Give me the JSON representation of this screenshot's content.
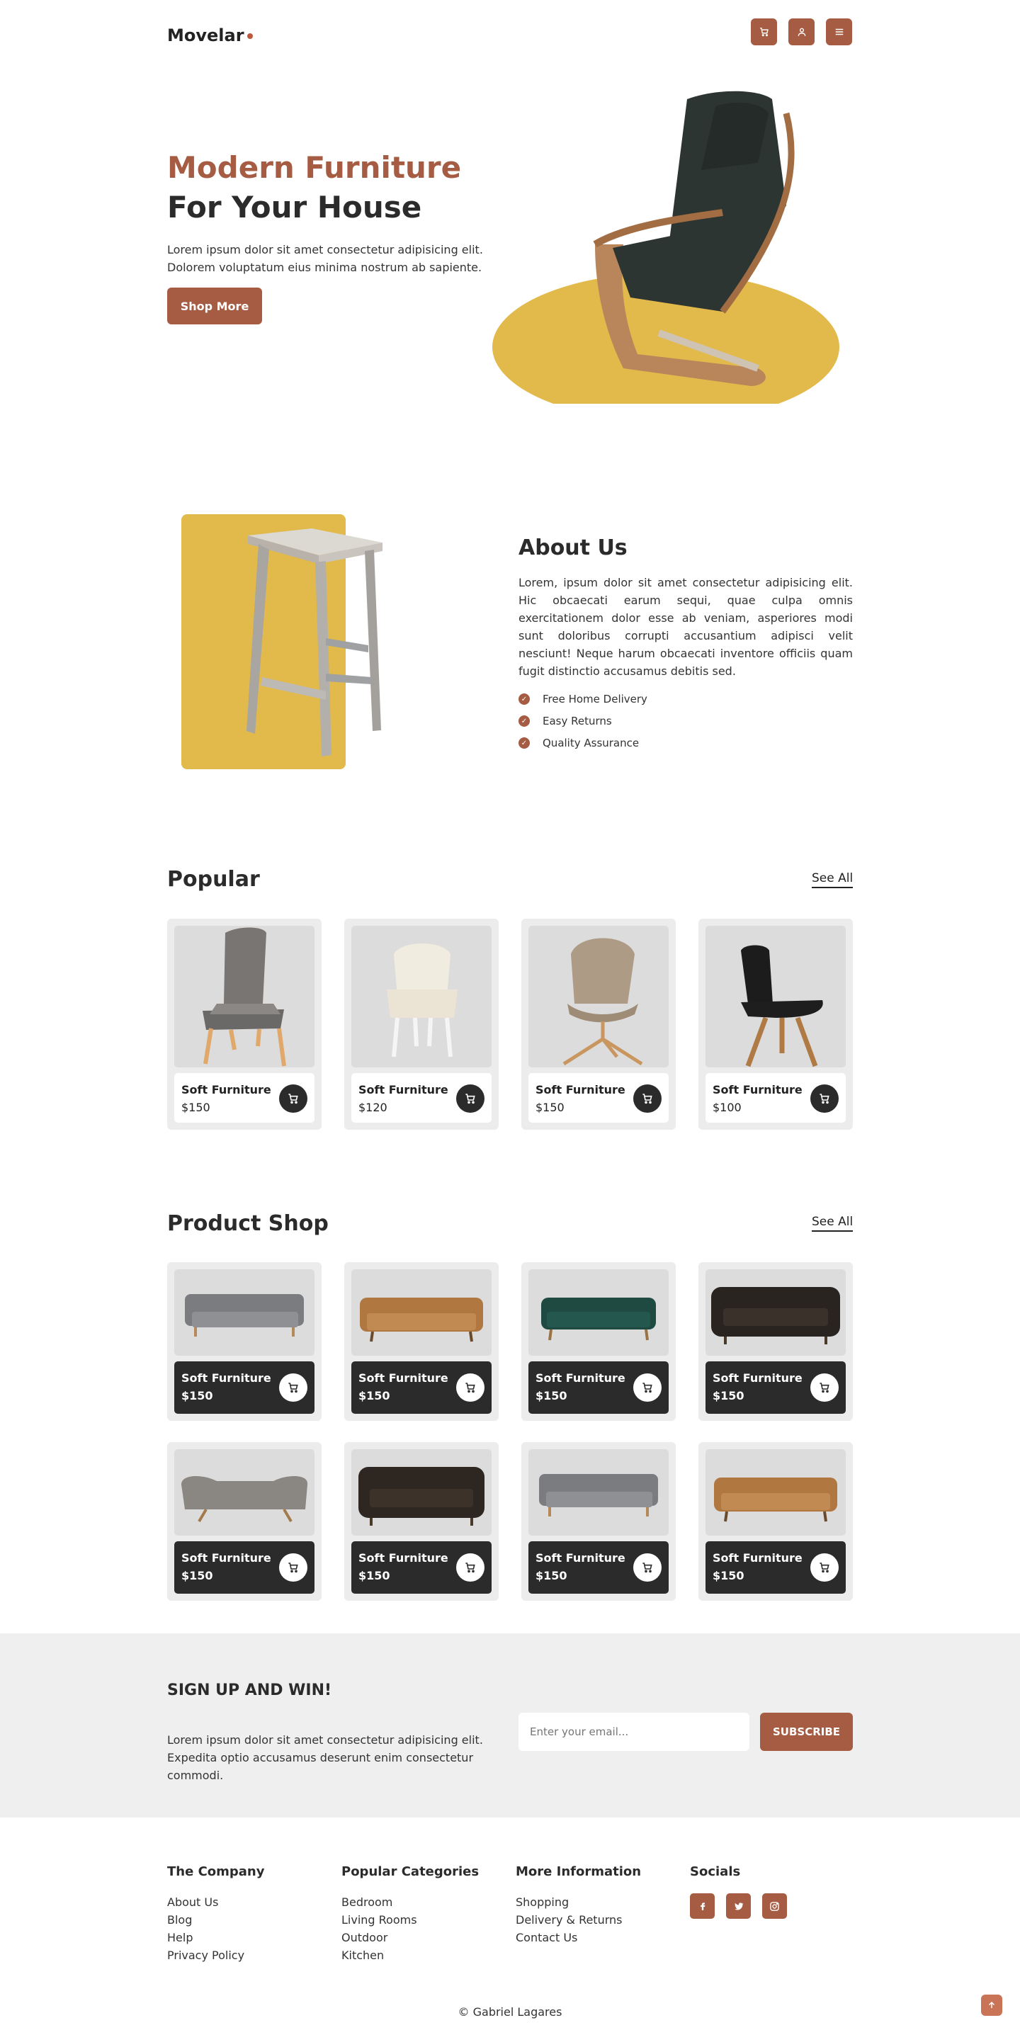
{
  "header": {
    "logo": "Movelar",
    "icons": [
      "cart-icon",
      "user-icon",
      "menu-icon"
    ]
  },
  "hero": {
    "title_accent": "Modern Furniture",
    "title_main": "For Your House",
    "paragraph": "Lorem ipsum dolor sit amet consectetur adipisicing elit. Dolorem voluptatum eius minima nostrum ab sapiente.",
    "button": "Shop More"
  },
  "about": {
    "title": "About Us",
    "paragraph": "Lorem, ipsum dolor sit amet consectetur adipisicing elit. Hic obcaecati earum sequi, quae culpa omnis exercitationem dolor esse ab veniam, asperiores modi sunt doloribus corrupti accusantium adipisci velit nesciunt! Neque harum obcaecati inventore officiis quam fugit distinctio accusamus debitis sed.",
    "features": [
      "Free Home Delivery",
      "Easy Returns",
      "Quality Assurance"
    ]
  },
  "popular": {
    "title": "Popular",
    "see_all": "See All",
    "items": [
      {
        "name": "Soft Furniture",
        "price": "$150"
      },
      {
        "name": "Soft Furniture",
        "price": "$120"
      },
      {
        "name": "Soft Furniture",
        "price": "$150"
      },
      {
        "name": "Soft Furniture",
        "price": "$100"
      }
    ]
  },
  "shop": {
    "title": "Product Shop",
    "see_all": "See All",
    "items": [
      {
        "name": "Soft Furniture",
        "price": "$150"
      },
      {
        "name": "Soft Furniture",
        "price": "$150"
      },
      {
        "name": "Soft Furniture",
        "price": "$150"
      },
      {
        "name": "Soft Furniture",
        "price": "$150"
      },
      {
        "name": "Soft Furniture",
        "price": "$150"
      },
      {
        "name": "Soft Furniture",
        "price": "$150"
      },
      {
        "name": "Soft Furniture",
        "price": "$150"
      },
      {
        "name": "Soft Furniture",
        "price": "$150"
      }
    ]
  },
  "signup": {
    "title": "SIGN UP AND WIN!",
    "paragraph": "Lorem ipsum dolor sit amet consectetur adipisicing elit. Expedita optio accusamus deserunt enim consectetur commodi.",
    "email_placeholder": "Enter your email...",
    "button": "SUBSCRIBE"
  },
  "footer": {
    "company": {
      "title": "The Company",
      "links": [
        "About Us",
        "Blog",
        "Help",
        "Privacy Policy"
      ]
    },
    "categories": {
      "title": "Popular Categories",
      "links": [
        "Bedroom",
        "Living Rooms",
        "Outdoor",
        "Kitchen"
      ]
    },
    "info": {
      "title": "More Information",
      "links": [
        "Shopping",
        "Delivery & Returns",
        "Contact Us"
      ]
    },
    "socials": {
      "title": "Socials",
      "icons": [
        "facebook-icon",
        "twitter-icon",
        "instagram-icon"
      ]
    },
    "copyright": "© Gabriel Lagares"
  },
  "colors": {
    "accent": "#a55c43",
    "yellow": "#e2b94b",
    "dark": "#2b2b2b",
    "panel": "#efefef"
  }
}
